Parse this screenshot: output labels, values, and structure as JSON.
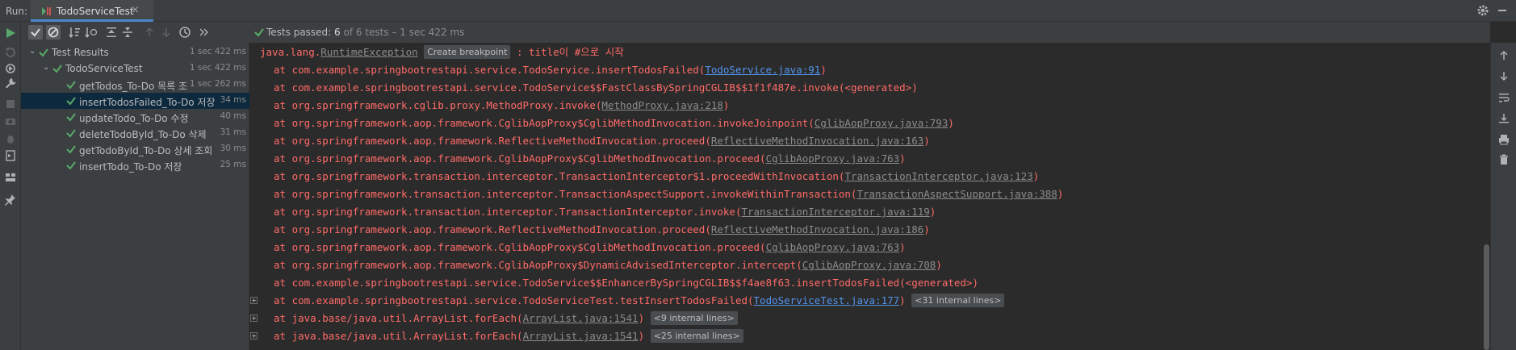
{
  "run_label": "Run:",
  "run_tab": {
    "title": "TodoServiceTest",
    "close": "×"
  },
  "status": {
    "prefix": "Tests passed: ",
    "passed": "6",
    "suffix": " of 6 tests – 1 sec 422 ms"
  },
  "tree": {
    "rows": [
      {
        "label": "Test Results",
        "time": "1 sec 422 ms"
      },
      {
        "label": "TodoServiceTest",
        "time": "1 sec 422 ms"
      },
      {
        "label": "getTodos_To-Do 목록 조",
        "time": "1 sec 262 ms"
      },
      {
        "label": "insertTodosFailed_To-Do 저장",
        "time": "34 ms"
      },
      {
        "label": "updateTodo_To-Do 수정",
        "time": "40 ms"
      },
      {
        "label": "deleteTodoById_To-Do 삭제",
        "time": "31 ms"
      },
      {
        "label": "getTodoById_To-Do 상세 조회",
        "time": "30 ms"
      },
      {
        "label": "insertTodo_To-Do 저장",
        "time": "25 ms"
      }
    ]
  },
  "console": {
    "exception": {
      "prefix": "java.lang.",
      "name": "RuntimeException",
      "breakpoint": "Create breakpoint",
      "message": " : title이 #으로 시작"
    },
    "frames": [
      {
        "text": "at com.example.springbootrestapi.service.TodoService.insertTodosFailed(",
        "link": "TodoService.java:91",
        "link_style": "blue",
        "tail": ")"
      },
      {
        "text": "at com.example.springbootrestapi.service.TodoService$$FastClassBySpringCGLIB$$1f1f487e.invoke(<generated>)",
        "link": "",
        "link_style": "",
        "tail": ""
      },
      {
        "text": "at org.springframework.cglib.proxy.MethodProxy.invoke(",
        "link": "MethodProxy.java:218",
        "link_style": "gray",
        "tail": ")"
      },
      {
        "text": "at org.springframework.aop.framework.CglibAopProxy$CglibMethodInvocation.invokeJoinpoint(",
        "link": "CglibAopProxy.java:793",
        "link_style": "gray",
        "tail": ")"
      },
      {
        "text": "at org.springframework.aop.framework.ReflectiveMethodInvocation.proceed(",
        "link": "ReflectiveMethodInvocation.java:163",
        "link_style": "gray",
        "tail": ")"
      },
      {
        "text": "at org.springframework.aop.framework.CglibAopProxy$CglibMethodInvocation.proceed(",
        "link": "CglibAopProxy.java:763",
        "link_style": "gray",
        "tail": ")"
      },
      {
        "text": "at org.springframework.transaction.interceptor.TransactionInterceptor$1.proceedWithInvocation(",
        "link": "TransactionInterceptor.java:123",
        "link_style": "gray",
        "tail": ")"
      },
      {
        "text": "at org.springframework.transaction.interceptor.TransactionAspectSupport.invokeWithinTransaction(",
        "link": "TransactionAspectSupport.java:388",
        "link_style": "gray",
        "tail": ")"
      },
      {
        "text": "at org.springframework.transaction.interceptor.TransactionInterceptor.invoke(",
        "link": "TransactionInterceptor.java:119",
        "link_style": "gray",
        "tail": ")"
      },
      {
        "text": "at org.springframework.aop.framework.ReflectiveMethodInvocation.proceed(",
        "link": "ReflectiveMethodInvocation.java:186",
        "link_style": "gray",
        "tail": ")"
      },
      {
        "text": "at org.springframework.aop.framework.CglibAopProxy$CglibMethodInvocation.proceed(",
        "link": "CglibAopProxy.java:763",
        "link_style": "gray",
        "tail": ")"
      },
      {
        "text": "at org.springframework.aop.framework.CglibAopProxy$DynamicAdvisedInterceptor.intercept(",
        "link": "CglibAopProxy.java:708",
        "link_style": "gray",
        "tail": ")"
      },
      {
        "text": "at com.example.springbootrestapi.service.TodoService$$EnhancerBySpringCGLIB$$f4ae8f63.insertTodosFailed(<generated>)",
        "link": "",
        "link_style": "",
        "tail": ""
      },
      {
        "text": "at com.example.springbootrestapi.service.TodoServiceTest.testInsertTodosFailed(",
        "link": "TodoServiceTest.java:177",
        "link_style": "blue",
        "tail": ")",
        "chip": "<31 internal lines>",
        "expandable": true
      },
      {
        "text": "at java.base/java.util.ArrayList.forEach(",
        "link": "ArrayList.java:1541",
        "link_style": "gray",
        "tail": ")",
        "chip": "<9 internal lines>",
        "expandable": true
      },
      {
        "text": "at java.base/java.util.ArrayList.forEach(",
        "link": "ArrayList.java:1541",
        "link_style": "gray",
        "tail": ")",
        "chip": "<25 internal lines>",
        "expandable": true
      }
    ]
  },
  "colors": {
    "accent": "#4a88c7",
    "error": "#ff6b68",
    "pass": "#59a869",
    "link": "#5394ec"
  }
}
